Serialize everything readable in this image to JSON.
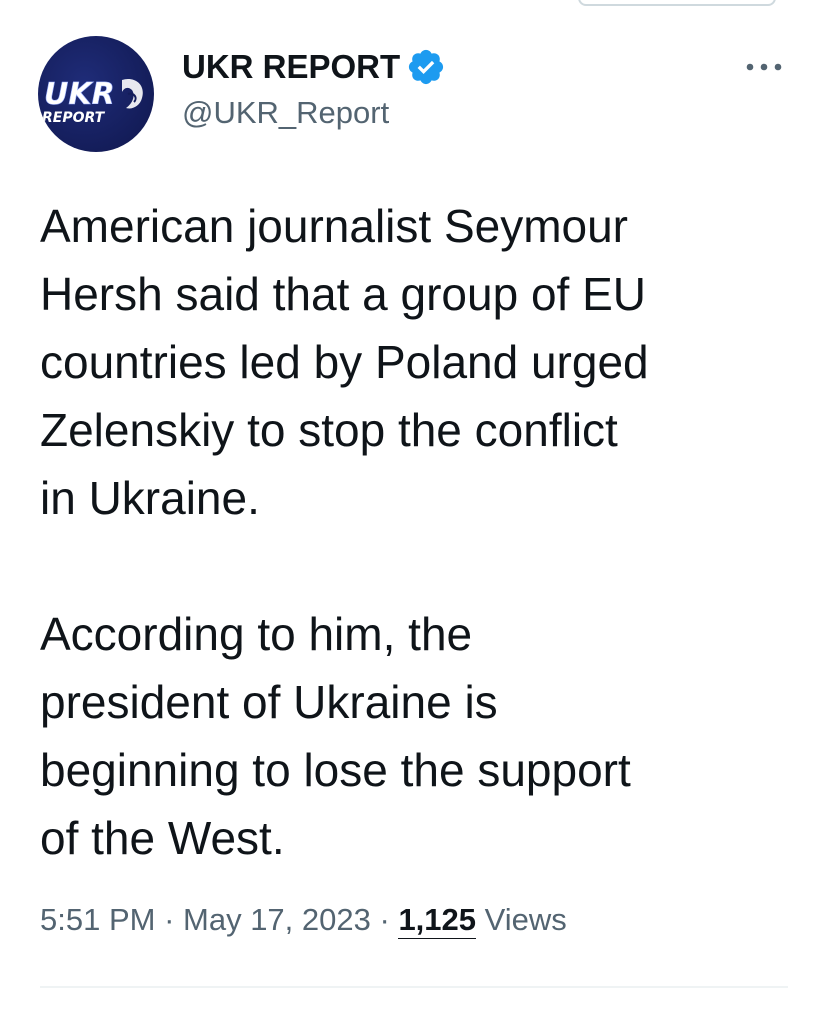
{
  "account": {
    "display_name": "UKR REPORT",
    "handle": "@UKR_Report",
    "verified": true,
    "avatar_logo_line1": "UKR",
    "avatar_logo_line2": "REPORT"
  },
  "tweet": {
    "paragraph_1": "American journalist Seymour\nHersh said that a group of EU\ncountries led by Poland urged\nZelenskiy to stop the conflict\nin Ukraine.",
    "paragraph_2": "According to him, the\npresident of Ukraine is\nbeginning to lose the support\nof the West.",
    "time": "5:51 PM",
    "separator": " · ",
    "date": "May 17, 2023",
    "views_count": "1,125",
    "views_label": "Views"
  },
  "colors": {
    "verified_blue": "#1d9bf0",
    "secondary_text": "#536471",
    "primary_text": "#0f1419",
    "avatar_bg": "#141d5a"
  },
  "icons": {
    "verified": "verified-badge-icon",
    "more": "more-horizontal-icon"
  }
}
